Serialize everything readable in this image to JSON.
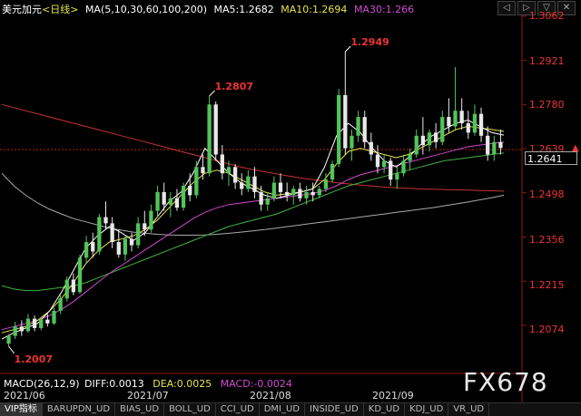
{
  "header": {
    "title": "美元加元",
    "period": "<日线>",
    "ma_label": "MA(5,10,30,60,100,200)",
    "ma5": "MA5:1.2682",
    "ma10": "MA10:1.2694",
    "ma30": "MA30:1.266"
  },
  "window_buttons": [
    "◁",
    "▷",
    "▽",
    "✕"
  ],
  "y_axis": {
    "ticks": [
      "1.3062",
      "1.2921",
      "1.2780",
      "1.2639",
      "1.2498",
      "1.2356",
      "1.2215",
      "1.2074"
    ],
    "current_price": "1.2641"
  },
  "annotations": {
    "high_jul": "1.2807",
    "high_aug": "1.2949",
    "low_jun": "1.2007"
  },
  "macd": {
    "label": "MACD(26,12,9)",
    "diff": "DIFF:0.0013",
    "dea": "DEA:0.0025",
    "macd": "MACD:-0.0024"
  },
  "x_axis": {
    "dates": [
      "2021/06",
      "2021/07",
      "2021/08",
      "2021/09"
    ]
  },
  "watermark": "FX678",
  "tabs": [
    "VIP指标",
    "BARUPDN_UD",
    "BIAS_UD",
    "BOLL_UD",
    "CCI_UD",
    "DMI_UD",
    "INSIDE_UD",
    "KD_UD",
    "KDJ_UD",
    "VR_UD"
  ],
  "colors": {
    "up": "#52c45a",
    "down": "#e8e8e8",
    "ma5": "#ffffff",
    "ma10": "#e8e34a",
    "ma30": "#d04ad0",
    "ma60": "#3fb03f",
    "ma100": "#aaaaaa",
    "ma200": "#c83232",
    "price_text": "#e33333"
  },
  "chart_data": {
    "type": "candlestick",
    "ylim": [
      1.2007,
      1.3062
    ],
    "candles": [
      [
        1.2015,
        1.2045,
        1.2007,
        1.204
      ],
      [
        1.204,
        1.2085,
        1.203,
        1.207
      ],
      [
        1.207,
        1.209,
        1.204,
        1.2055
      ],
      [
        1.2055,
        1.211,
        1.205,
        1.2095
      ],
      [
        1.2095,
        1.2105,
        1.2055,
        1.2065
      ],
      [
        1.2065,
        1.21,
        1.2058,
        1.2092
      ],
      [
        1.2092,
        1.211,
        1.207,
        1.208
      ],
      [
        1.208,
        1.213,
        1.2075,
        1.212
      ],
      [
        1.212,
        1.217,
        1.211,
        1.216
      ],
      [
        1.216,
        1.223,
        1.215,
        1.222
      ],
      [
        1.222,
        1.224,
        1.217,
        1.218
      ],
      [
        1.218,
        1.23,
        1.2175,
        1.229
      ],
      [
        1.229,
        1.236,
        1.227,
        1.234
      ],
      [
        1.234,
        1.237,
        1.229,
        1.231
      ],
      [
        1.231,
        1.243,
        1.23,
        1.242
      ],
      [
        1.242,
        1.247,
        1.238,
        1.24
      ],
      [
        1.24,
        1.242,
        1.232,
        1.234
      ],
      [
        1.234,
        1.238,
        1.229,
        1.23
      ],
      [
        1.23,
        1.236,
        1.228,
        1.235
      ],
      [
        1.235,
        1.237,
        1.231,
        1.233
      ],
      [
        1.233,
        1.242,
        1.232,
        1.24
      ],
      [
        1.24,
        1.244,
        1.236,
        1.238
      ],
      [
        1.238,
        1.246,
        1.237,
        1.244
      ],
      [
        1.244,
        1.252,
        1.242,
        1.25
      ],
      [
        1.25,
        1.253,
        1.244,
        1.246
      ],
      [
        1.246,
        1.25,
        1.242,
        1.248
      ],
      [
        1.248,
        1.251,
        1.244,
        1.245
      ],
      [
        1.245,
        1.253,
        1.244,
        1.252
      ],
      [
        1.252,
        1.256,
        1.247,
        1.249
      ],
      [
        1.249,
        1.26,
        1.248,
        1.258
      ],
      [
        1.258,
        1.262,
        1.254,
        1.256
      ],
      [
        1.256,
        1.2807,
        1.255,
        1.278
      ],
      [
        1.278,
        1.279,
        1.26,
        1.262
      ],
      [
        1.262,
        1.265,
        1.254,
        1.256
      ],
      [
        1.256,
        1.26,
        1.252,
        1.258
      ],
      [
        1.258,
        1.259,
        1.251,
        1.253
      ],
      [
        1.253,
        1.256,
        1.249,
        1.251
      ],
      [
        1.251,
        1.257,
        1.25,
        1.255
      ],
      [
        1.255,
        1.258,
        1.248,
        1.25
      ],
      [
        1.25,
        1.252,
        1.244,
        1.246
      ],
      [
        1.246,
        1.25,
        1.244,
        1.248
      ],
      [
        1.248,
        1.255,
        1.247,
        1.253
      ],
      [
        1.253,
        1.256,
        1.248,
        1.25
      ],
      [
        1.25,
        1.253,
        1.247,
        1.249
      ],
      [
        1.249,
        1.252,
        1.246,
        1.251
      ],
      [
        1.251,
        1.253,
        1.247,
        1.248
      ],
      [
        1.248,
        1.252,
        1.246,
        1.25
      ],
      [
        1.25,
        1.253,
        1.247,
        1.249
      ],
      [
        1.249,
        1.252,
        1.248,
        1.251
      ],
      [
        1.251,
        1.256,
        1.25,
        1.254
      ],
      [
        1.254,
        1.26,
        1.253,
        1.259
      ],
      [
        1.259,
        1.283,
        1.258,
        1.281
      ],
      [
        1.281,
        1.2949,
        1.262,
        1.264
      ],
      [
        1.264,
        1.27,
        1.26,
        1.268
      ],
      [
        1.268,
        1.276,
        1.266,
        1.274
      ],
      [
        1.274,
        1.276,
        1.264,
        1.266
      ],
      [
        1.266,
        1.269,
        1.26,
        1.262
      ],
      [
        1.262,
        1.265,
        1.256,
        1.258
      ],
      [
        1.258,
        1.262,
        1.256,
        1.26
      ],
      [
        1.26,
        1.261,
        1.252,
        1.254
      ],
      [
        1.254,
        1.258,
        1.251,
        1.256
      ],
      [
        1.256,
        1.262,
        1.255,
        1.26
      ],
      [
        1.26,
        1.264,
        1.257,
        1.262
      ],
      [
        1.262,
        1.27,
        1.261,
        1.268
      ],
      [
        1.268,
        1.274,
        1.262,
        1.265
      ],
      [
        1.265,
        1.27,
        1.263,
        1.269
      ],
      [
        1.269,
        1.272,
        1.264,
        1.266
      ],
      [
        1.266,
        1.276,
        1.265,
        1.274
      ],
      [
        1.274,
        1.28,
        1.269,
        1.271
      ],
      [
        1.271,
        1.29,
        1.27,
        1.276
      ],
      [
        1.276,
        1.28,
        1.27,
        1.272
      ],
      [
        1.272,
        1.276,
        1.267,
        1.269
      ],
      [
        1.269,
        1.278,
        1.268,
        1.275
      ],
      [
        1.275,
        1.277,
        1.266,
        1.268
      ],
      [
        1.268,
        1.271,
        1.26,
        1.262
      ],
      [
        1.262,
        1.268,
        1.26,
        1.266
      ],
      [
        1.266,
        1.27,
        1.262,
        1.2641
      ]
    ],
    "ma_lines": {
      "ma5": [
        1.203,
        1.205,
        1.2065,
        1.208,
        1.212,
        1.218,
        1.225,
        1.232,
        1.236,
        1.239,
        1.237,
        1.2345,
        1.237,
        1.242,
        1.247,
        1.25,
        1.256,
        1.264,
        1.26,
        1.256,
        1.253,
        1.251,
        1.249,
        1.248,
        1.249,
        1.25,
        1.251,
        1.258,
        1.268,
        1.272,
        1.269,
        1.264,
        1.26,
        1.258,
        1.261,
        1.265,
        1.268,
        1.27,
        1.272,
        1.273,
        1.271,
        1.269,
        1.2682
      ],
      "ma10": [
        1.205,
        1.206,
        1.207,
        1.209,
        1.212,
        1.216,
        1.221,
        1.227,
        1.231,
        1.234,
        1.235,
        1.236,
        1.238,
        1.241,
        1.245,
        1.249,
        1.253,
        1.256,
        1.257,
        1.256,
        1.254,
        1.252,
        1.25,
        1.249,
        1.2495,
        1.25,
        1.251,
        1.254,
        1.259,
        1.263,
        1.264,
        1.263,
        1.262,
        1.261,
        1.262,
        1.264,
        1.266,
        1.268,
        1.27,
        1.271,
        1.2705,
        1.27,
        1.2694
      ],
      "ma30": [
        1.206,
        1.207,
        1.208,
        1.209,
        1.2105,
        1.2125,
        1.215,
        1.218,
        1.221,
        1.224,
        1.2265,
        1.229,
        1.2315,
        1.234,
        1.2365,
        1.239,
        1.2415,
        1.2435,
        1.245,
        1.246,
        1.2465,
        1.247,
        1.2475,
        1.248,
        1.2485,
        1.249,
        1.2495,
        1.2505,
        1.252,
        1.254,
        1.2555,
        1.2565,
        1.2575,
        1.2585,
        1.2595,
        1.2605,
        1.2615,
        1.2625,
        1.2635,
        1.2645,
        1.265,
        1.2655,
        1.266
      ],
      "ma60": [
        1.22,
        1.219,
        1.2185,
        1.2185,
        1.219,
        1.2195,
        1.22,
        1.221,
        1.2225,
        1.224,
        1.2255,
        1.227,
        1.2285,
        1.23,
        1.2315,
        1.233,
        1.2345,
        1.236,
        1.2375,
        1.239,
        1.24,
        1.241,
        1.242,
        1.243,
        1.2445,
        1.246,
        1.2475,
        1.249,
        1.2505,
        1.252,
        1.253,
        1.254,
        1.255,
        1.256,
        1.257,
        1.258,
        1.259,
        1.26,
        1.2605,
        1.261,
        1.2615,
        1.262,
        1.2625
      ],
      "ma100": [
        1.256,
        1.252,
        1.249,
        1.2465,
        1.2445,
        1.243,
        1.2415,
        1.2405,
        1.2395,
        1.2385,
        1.2378,
        1.2372,
        1.2368,
        1.2365,
        1.2363,
        1.2362,
        1.2362,
        1.2363,
        1.2365,
        1.2368,
        1.2372,
        1.2376,
        1.238,
        1.2385,
        1.239,
        1.2395,
        1.24,
        1.2405,
        1.241,
        1.2415,
        1.242,
        1.2425,
        1.243,
        1.2435,
        1.244,
        1.2445,
        1.245,
        1.2456,
        1.2462,
        1.2468,
        1.2475,
        1.2482,
        1.249
      ],
      "ma200": [
        1.278,
        1.277,
        1.276,
        1.275,
        1.274,
        1.273,
        1.272,
        1.271,
        1.27,
        1.269,
        1.268,
        1.267,
        1.266,
        1.265,
        1.264,
        1.263,
        1.262,
        1.261,
        1.26,
        1.259,
        1.258,
        1.2572,
        1.2565,
        1.2558,
        1.2551,
        1.2545,
        1.254,
        1.2535,
        1.253,
        1.2526,
        1.2522,
        1.2519,
        1.2516,
        1.2514,
        1.2512,
        1.251,
        1.2509,
        1.2508,
        1.2507,
        1.2506,
        1.2505,
        1.2504,
        1.2503
      ]
    }
  }
}
